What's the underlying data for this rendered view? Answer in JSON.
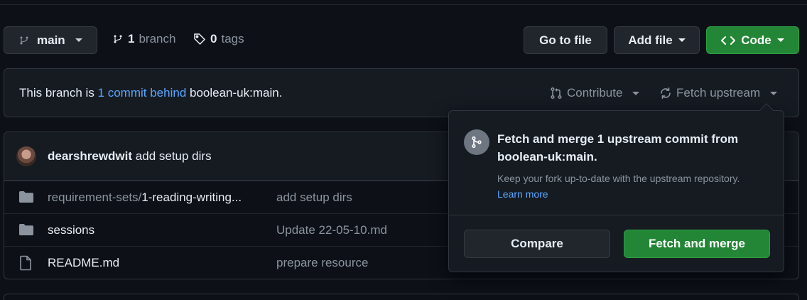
{
  "branch": {
    "name": "main",
    "branches_count": "1",
    "branches_label": "branch",
    "tags_count": "0",
    "tags_label": "tags"
  },
  "actions": {
    "go_to_file": "Go to file",
    "add_file": "Add file",
    "code": "Code"
  },
  "banner": {
    "prefix": "This branch is ",
    "behind_link": "1 commit behind",
    "suffix": " boolean-uk:main.",
    "contribute": "Contribute",
    "fetch_upstream": "Fetch upstream"
  },
  "latest_commit": {
    "author": "dearshrewdwit",
    "message": "add setup dirs"
  },
  "files": [
    {
      "type": "folder",
      "dir": "requirement-sets/",
      "name": "1-reading-writing...",
      "message": "add setup dirs"
    },
    {
      "type": "folder",
      "dir": "",
      "name": "sessions",
      "message": "Update 22-05-10.md"
    },
    {
      "type": "file",
      "dir": "",
      "name": "README.md",
      "message": "prepare resource"
    }
  ],
  "popover": {
    "title": "Fetch and merge 1 upstream commit from boolean-uk:main.",
    "description": "Keep your fork up-to-date with the upstream repository.",
    "learn_more": "Learn more",
    "compare": "Compare",
    "fetch_merge": "Fetch and merge"
  },
  "colors": {
    "accent_link": "#58a6ff",
    "primary_button": "#238636",
    "background": "#0d1117"
  }
}
